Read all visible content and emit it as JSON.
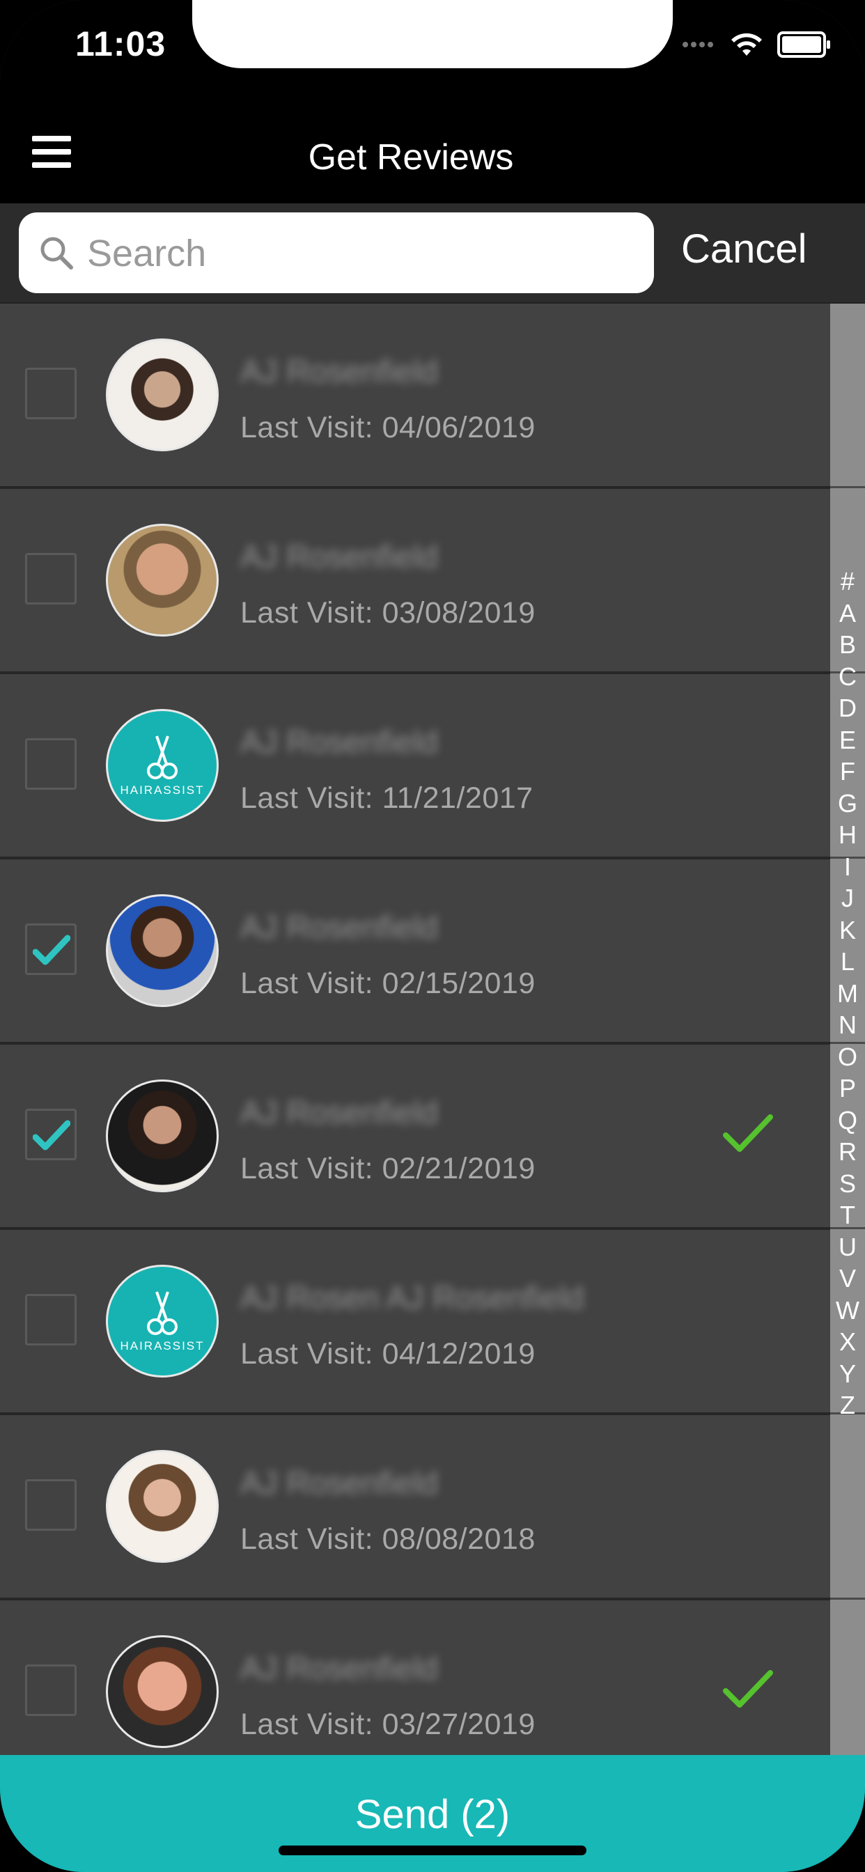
{
  "status_bar": {
    "time": "11:03"
  },
  "header": {
    "title": "Get Reviews"
  },
  "search": {
    "placeholder": "Search",
    "value": "",
    "cancel_label": "Cancel"
  },
  "contacts": [
    {
      "name": "AJ Rosenfield",
      "last_visit": "Last Visit: 04/06/2019",
      "avatar": "photo",
      "selected": false,
      "sent": false
    },
    {
      "name": "AJ Rosenfield",
      "last_visit": "Last Visit: 03/08/2019",
      "avatar": "photo",
      "selected": false,
      "sent": false
    },
    {
      "name": "AJ Rosenfield",
      "last_visit": "Last Visit: 11/21/2017",
      "avatar": "hairassist-logo",
      "selected": false,
      "sent": false
    },
    {
      "name": "AJ Rosenfield",
      "last_visit": "Last Visit: 02/15/2019",
      "avatar": "photo",
      "selected": true,
      "sent": false
    },
    {
      "name": "AJ Rosenfield",
      "last_visit": "Last Visit: 02/21/2019",
      "avatar": "photo",
      "selected": true,
      "sent": true
    },
    {
      "name": "AJ Rosen AJ Rosenfield",
      "last_visit": "Last Visit: 04/12/2019",
      "avatar": "hairassist-logo",
      "selected": false,
      "sent": false
    },
    {
      "name": "AJ Rosenfield",
      "last_visit": "Last Visit: 08/08/2018",
      "avatar": "photo",
      "selected": false,
      "sent": false
    },
    {
      "name": "AJ Rosenfield",
      "last_visit": "Last Visit: 03/27/2019",
      "avatar": "photo",
      "selected": false,
      "sent": true
    }
  ],
  "avatar_logo_text": "HAIRASSIST",
  "index_letters": [
    "#",
    "A",
    "B",
    "C",
    "D",
    "E",
    "F",
    "G",
    "H",
    "I",
    "J",
    "K",
    "L",
    "M",
    "N",
    "O",
    "P",
    "Q",
    "R",
    "S",
    "T",
    "U",
    "V",
    "W",
    "X",
    "Y",
    "Z"
  ],
  "send": {
    "label": "Send (2)"
  },
  "colors": {
    "accent": "#17b8b6",
    "check_selected": "#2fc4c1",
    "check_sent": "#55c22e",
    "row_bg": "#424242"
  }
}
